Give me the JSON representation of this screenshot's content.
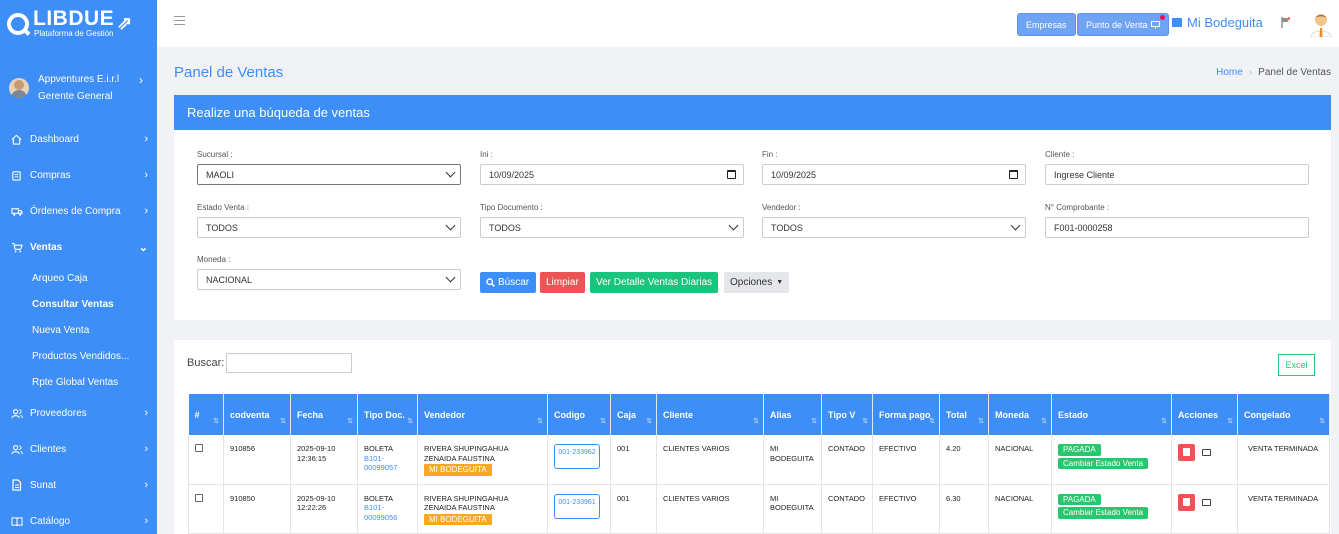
{
  "sidebar": {
    "logo_title": "LIBDUE",
    "logo_sub": "Plataforma de Gestión",
    "user_name": "Appventures E.i.r.l",
    "user_role": "Gerente General",
    "items": [
      {
        "label": "Dashboard",
        "icon": "home-icon"
      },
      {
        "label": "Compras",
        "icon": "clipboard-icon"
      },
      {
        "label": "Órdenes de Compra",
        "icon": "truck-icon"
      },
      {
        "label": "Ventas",
        "icon": "cart-icon"
      },
      {
        "label": "Proveedores",
        "icon": "users-icon"
      },
      {
        "label": "Clientes",
        "icon": "users-icon"
      },
      {
        "label": "Sunat",
        "icon": "document-icon"
      },
      {
        "label": "Catálogo",
        "icon": "book-icon"
      }
    ],
    "ventas_sub": [
      "Arqueo Caja",
      "Consultar Ventas",
      "Nueva Venta",
      "Productos Vendidos...",
      "Rpte Global Ventas"
    ]
  },
  "topbar": {
    "empresas": "Empresas",
    "punto_venta": "Punto de Venta",
    "store": "Mi Bodeguita"
  },
  "header": {
    "title": "Panel de Ventas",
    "crumb_home": "Home",
    "crumb_current": "Panel de Ventas"
  },
  "search": {
    "heading": "Realize una búqueda de ventas",
    "sucursal_label": "Sucursal :",
    "sucursal_value": "MAOLI",
    "ini_label": "Ini :",
    "ini_value": "10/09/2025",
    "fin_label": "Fin :",
    "fin_value": "10/09/2025",
    "cliente_label": "Cliente :",
    "cliente_placeholder": "Ingrese Cliente",
    "estado_label": "Estado Venta :",
    "estado_value": "TODOS",
    "tipo_doc_label": "Tipo Documento :",
    "tipo_doc_value": "TODOS",
    "vendedor_label": "Vendedor :",
    "vendedor_value": "TODOS",
    "comprobante_label": "N° Comprobante :",
    "comprobante_value": "F001-0000258",
    "moneda_label": "Moneda :",
    "moneda_value": "NACIONAL",
    "btn_buscar": "Búscar",
    "btn_limpiar": "Limpiar",
    "btn_detalle": "Ver Detalle Ventas Diarias",
    "btn_opciones": "Opciones"
  },
  "table": {
    "search_label": "Buscar:",
    "excel": "Excel",
    "headers": [
      "#",
      "codventa",
      "Fecha",
      "Tipo Doc.",
      "Vendedor",
      "Codigo",
      "Caja",
      "Cliente",
      "Alias",
      "Tipo V",
      "Forma pago",
      "Total",
      "Moneda",
      "Estado",
      "Acciones",
      "Congelado"
    ],
    "rows": [
      {
        "codventa": "910856",
        "fecha": "2025-09-10 12:36:15",
        "tipo": "BOLETA",
        "doc": "B101-00099057",
        "vendedor": "RIVERA SHUPINGAHUA ZENAIDA FAUSTINA",
        "tienda": "MI BODEGUITA",
        "codigo": "001-233962",
        "caja": "001",
        "cliente": "CLIENTES VARIOS",
        "alias": "MI BODEGUITA",
        "tipo_v": "CONTADO",
        "forma_pago": "EFECTIVO",
        "total": "4.20",
        "moneda": "NACIONAL",
        "estado": "PAGADA",
        "cambiar": "Cambiar Estado Venta",
        "congelado": "VENTA TERMINADA"
      },
      {
        "codventa": "910850",
        "fecha": "2025-09-10 12:22:26",
        "tipo": "BOLETA",
        "doc": "B101-00099056",
        "vendedor": "RIVERA SHUPINGAHUA ZENAIDA FAUSTINA",
        "tienda": "MI BODEGUITA",
        "codigo": "001-233961",
        "caja": "001",
        "cliente": "CLIENTES VARIOS",
        "alias": "MI BODEGUITA",
        "tipo_v": "CONTADO",
        "forma_pago": "EFECTIVO",
        "total": "6.30",
        "moneda": "NACIONAL",
        "estado": "PAGADA",
        "cambiar": "Cambiar Estado Venta",
        "congelado": "VENTA TERMINADA"
      }
    ]
  },
  "colors": {
    "primary": "#3e8ef7",
    "danger": "#ea5455",
    "success": "#28c76f",
    "warning": "#f9a825"
  }
}
